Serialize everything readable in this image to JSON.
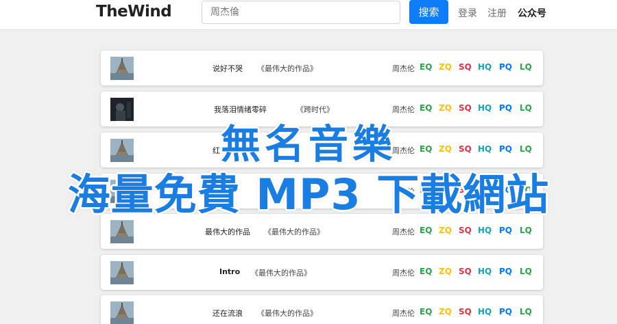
{
  "navbar": {
    "brand": "TheWind",
    "search_placeholder": "周杰倫",
    "search_button": "搜索",
    "login": "登录",
    "register": "注册",
    "wechat": "公众号"
  },
  "songs": [
    {
      "title": "说好不哭",
      "album": "《最伟大的作品》",
      "artist": "周杰伦",
      "cover_icon": "album-cover-castle-icon"
    },
    {
      "title": "我落泪情绪零碎",
      "album": "《跨时代》",
      "artist": "周杰伦",
      "cover_icon": "album-cover-dark-icon"
    },
    {
      "title": "红",
      "album": "",
      "artist": "周杰伦",
      "cover_icon": "album-cover-castle-icon"
    },
    {
      "title": "",
      "album": "",
      "artist": "周杰伦",
      "cover_icon": "album-cover-castle-icon"
    },
    {
      "title": "最伟大的作品",
      "album": "《最伟大的作品》",
      "artist": "周杰伦",
      "cover_icon": "album-cover-castle-icon"
    },
    {
      "title": "Intro",
      "album": "《最伟大的作品》",
      "artist": "周杰伦",
      "cover_icon": "album-cover-castle-icon"
    },
    {
      "title": "还在流浪",
      "album": "《最伟大的作品》",
      "artist": "周杰伦",
      "cover_icon": "album-cover-castle-icon"
    }
  ],
  "qualities": [
    {
      "label": "EQ",
      "color": "#28a745"
    },
    {
      "label": "ZQ",
      "color": "#ffc107"
    },
    {
      "label": "SQ",
      "color": "#dc3545"
    },
    {
      "label": "HQ",
      "color": "#17a2b8"
    },
    {
      "label": "PQ",
      "color": "#007bff"
    },
    {
      "label": "LQ",
      "color": "#28a745"
    }
  ],
  "overlay": {
    "line1": "無名音樂",
    "line2": "海量免費 MP3 下載網站"
  },
  "colors": {
    "accent": "#0d7cf8",
    "overlay_text": "#1a7de2",
    "page_bg": "#f0f0f0"
  }
}
